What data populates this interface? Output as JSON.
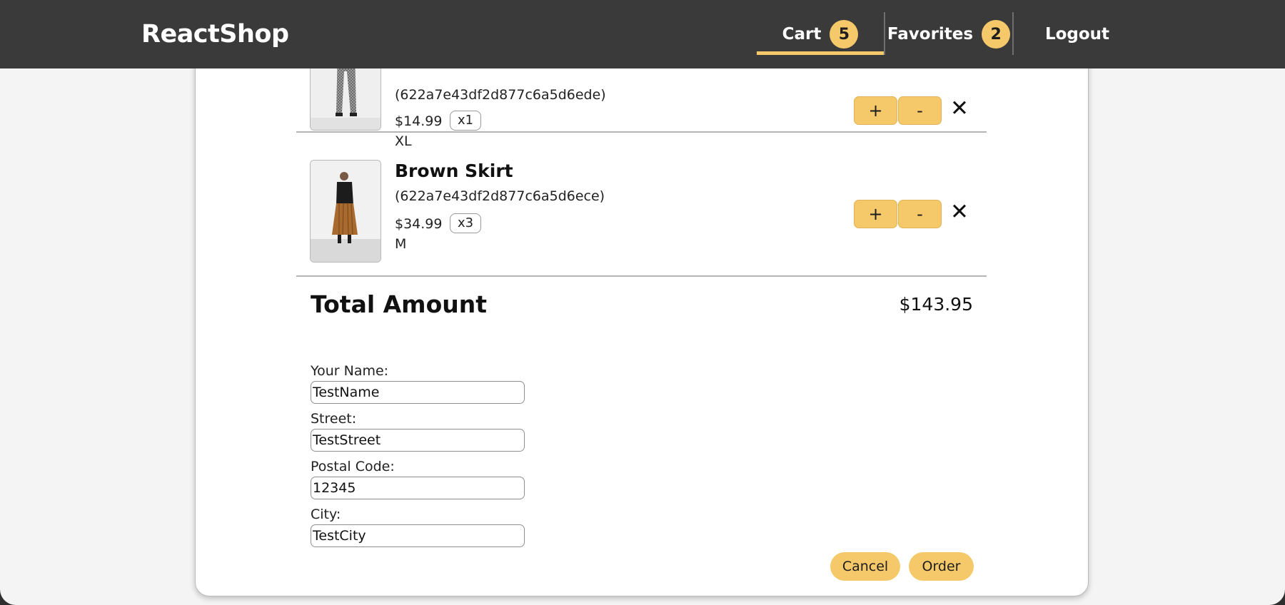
{
  "header": {
    "brand": "ReactShop",
    "nav": {
      "cart_label": "Cart",
      "cart_count": "5",
      "favorites_label": "Favorites",
      "favorites_count": "2",
      "logout_label": "Logout"
    }
  },
  "cart": {
    "items": [
      {
        "name": "",
        "id": "(622a7e43df2d877c6a5d6ede)",
        "price": "$14.99",
        "qty": "x1",
        "size": "XL",
        "plus": "+",
        "minus": "-",
        "remove": "✕"
      },
      {
        "name": "Brown Skirt",
        "id": "(622a7e43df2d877c6a5d6ece)",
        "price": "$34.99",
        "qty": "x3",
        "size": "M",
        "plus": "+",
        "minus": "-",
        "remove": "✕"
      }
    ],
    "total_label": "Total Amount",
    "total_value": "$143.95"
  },
  "checkout_form": {
    "name_label": "Your Name:",
    "name_value": "TestName",
    "street_label": "Street:",
    "street_value": "TestStreet",
    "postal_label": "Postal Code:",
    "postal_value": "12345",
    "city_label": "City:",
    "city_value": "TestCity",
    "cancel_label": "Cancel",
    "order_label": "Order"
  },
  "colors": {
    "header_bg": "#3a3a3a",
    "accent": "#f5c96a",
    "page_bg": "#f4f4f4"
  }
}
